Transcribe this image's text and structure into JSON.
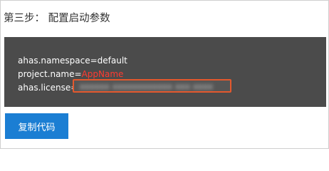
{
  "step": {
    "label": "第三步：",
    "title": "配置启动参数"
  },
  "code": {
    "namespace_line": "ahas.namespace=default",
    "project_prefix": "project.name=",
    "project_value": "AppName",
    "license_prefix": "ahas.license=",
    "license_value": "xxxxxx xxxxxxxxxxxx xxx xxxx"
  },
  "actions": {
    "copy_label": "复制代码"
  },
  "colors": {
    "panel_bg": "#4b4b4b",
    "highlight_red": "#ff3b30",
    "box_border": "#e4582d",
    "button_bg": "#1b7ed3"
  }
}
